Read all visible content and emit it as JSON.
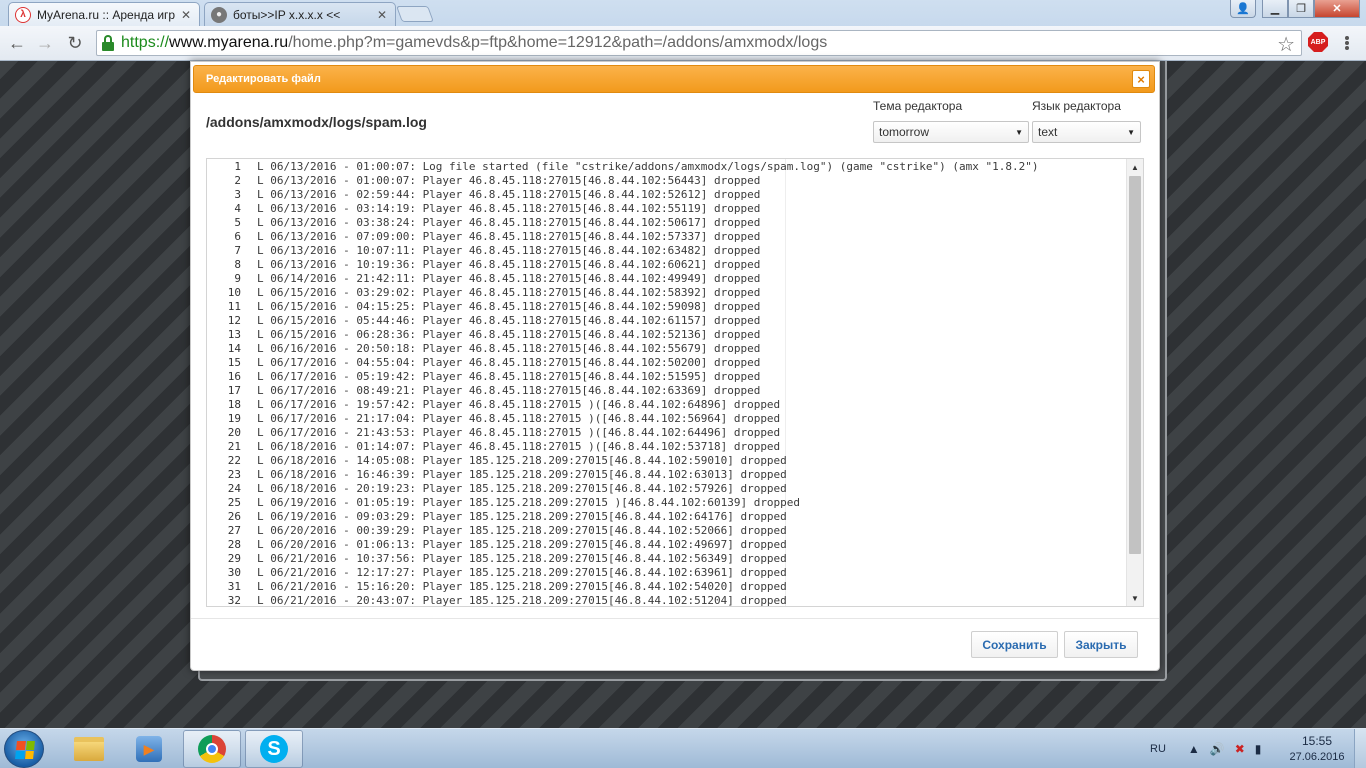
{
  "browser": {
    "tabs": [
      {
        "title": "MyArena.ru :: Аренда игр",
        "active": true
      },
      {
        "title": "боты>>IP x.x.x.x <<",
        "active": false
      }
    ],
    "url": {
      "scheme": "https://",
      "host": "www.myarena.ru",
      "path": "/home.php?m=gamevds&p=ftp&home=12912&path=/addons/amxmodx/logs"
    },
    "abp_label": "ABP"
  },
  "modal": {
    "title": "Редактировать файл",
    "close_glyph": "×",
    "file_path": "/addons/amxmodx/logs/spam.log",
    "theme": {
      "label": "Тема редактора",
      "value": "tomorrow"
    },
    "language": {
      "label": "Язык редактора",
      "value": "text"
    },
    "save_label": "Сохранить",
    "close_label": "Закрыть",
    "log_lines": [
      "L 06/13/2016 - 01:00:07: Log file started (file \"cstrike/addons/amxmodx/logs/spam.log\") (game \"cstrike\") (amx \"1.8.2\")",
      "L 06/13/2016 - 01:00:07: Player 46.8.45.118:27015[46.8.44.102:56443] dropped",
      "L 06/13/2016 - 02:59:44: Player 46.8.45.118:27015[46.8.44.102:52612] dropped",
      "L 06/13/2016 - 03:14:19: Player 46.8.45.118:27015[46.8.44.102:55119] dropped",
      "L 06/13/2016 - 03:38:24: Player 46.8.45.118:27015[46.8.44.102:50617] dropped",
      "L 06/13/2016 - 07:09:00: Player 46.8.45.118:27015[46.8.44.102:57337] dropped",
      "L 06/13/2016 - 10:07:11: Player 46.8.45.118:27015[46.8.44.102:63482] dropped",
      "L 06/13/2016 - 10:19:36: Player 46.8.45.118:27015[46.8.44.102:60621] dropped",
      "L 06/14/2016 - 21:42:11: Player 46.8.45.118:27015[46.8.44.102:49949] dropped",
      "L 06/15/2016 - 03:29:02: Player 46.8.45.118:27015[46.8.44.102:58392] dropped",
      "L 06/15/2016 - 04:15:25: Player 46.8.45.118:27015[46.8.44.102:59098] dropped",
      "L 06/15/2016 - 05:44:46: Player 46.8.45.118:27015[46.8.44.102:61157] dropped",
      "L 06/15/2016 - 06:28:36: Player 46.8.45.118:27015[46.8.44.102:52136] dropped",
      "L 06/16/2016 - 20:50:18: Player 46.8.45.118:27015[46.8.44.102:55679] dropped",
      "L 06/17/2016 - 04:55:04: Player 46.8.45.118:27015[46.8.44.102:50200] dropped",
      "L 06/17/2016 - 05:19:42: Player 46.8.45.118:27015[46.8.44.102:51595] dropped",
      "L 06/17/2016 - 08:49:21: Player 46.8.45.118:27015[46.8.44.102:63369] dropped",
      "L 06/17/2016 - 19:57:42: Player 46.8.45.118:27015 )([46.8.44.102:64896] dropped",
      "L 06/17/2016 - 21:17:04: Player 46.8.45.118:27015 )([46.8.44.102:56964] dropped",
      "L 06/17/2016 - 21:43:53: Player 46.8.45.118:27015 )([46.8.44.102:64496] dropped",
      "L 06/18/2016 - 01:14:07: Player 46.8.45.118:27015 )([46.8.44.102:53718] dropped",
      "L 06/18/2016 - 14:05:08: Player 185.125.218.209:27015[46.8.44.102:59010] dropped",
      "L 06/18/2016 - 16:46:39: Player 185.125.218.209:27015[46.8.44.102:63013] dropped",
      "L 06/18/2016 - 20:19:23: Player 185.125.218.209:27015[46.8.44.102:57926] dropped",
      "L 06/19/2016 - 01:05:19: Player 185.125.218.209:27015 )[46.8.44.102:60139] dropped",
      "L 06/19/2016 - 09:03:29: Player 185.125.218.209:27015[46.8.44.102:64176] dropped",
      "L 06/20/2016 - 00:39:29: Player 185.125.218.209:27015[46.8.44.102:52066] dropped",
      "L 06/20/2016 - 01:06:13: Player 185.125.218.209:27015[46.8.44.102:49697] dropped",
      "L 06/21/2016 - 10:37:56: Player 185.125.218.209:27015[46.8.44.102:56349] dropped",
      "L 06/21/2016 - 12:17:27: Player 185.125.218.209:27015[46.8.44.102:63961] dropped",
      "L 06/21/2016 - 15:16:20: Player 185.125.218.209:27015[46.8.44.102:54020] dropped",
      "L 06/21/2016 - 20:43:07: Player 185.125.218.209:27015[46.8.44.102:51204] dropped"
    ]
  },
  "taskbar": {
    "items": [
      "explorer",
      "media-player",
      "chrome",
      "skype"
    ],
    "language": "RU",
    "time": "15:55",
    "date": "27.06.2016"
  },
  "colors": {
    "modal_header": "#f5a020",
    "button_text": "#2a6bb0",
    "url_secure": "#1c8b1c"
  }
}
